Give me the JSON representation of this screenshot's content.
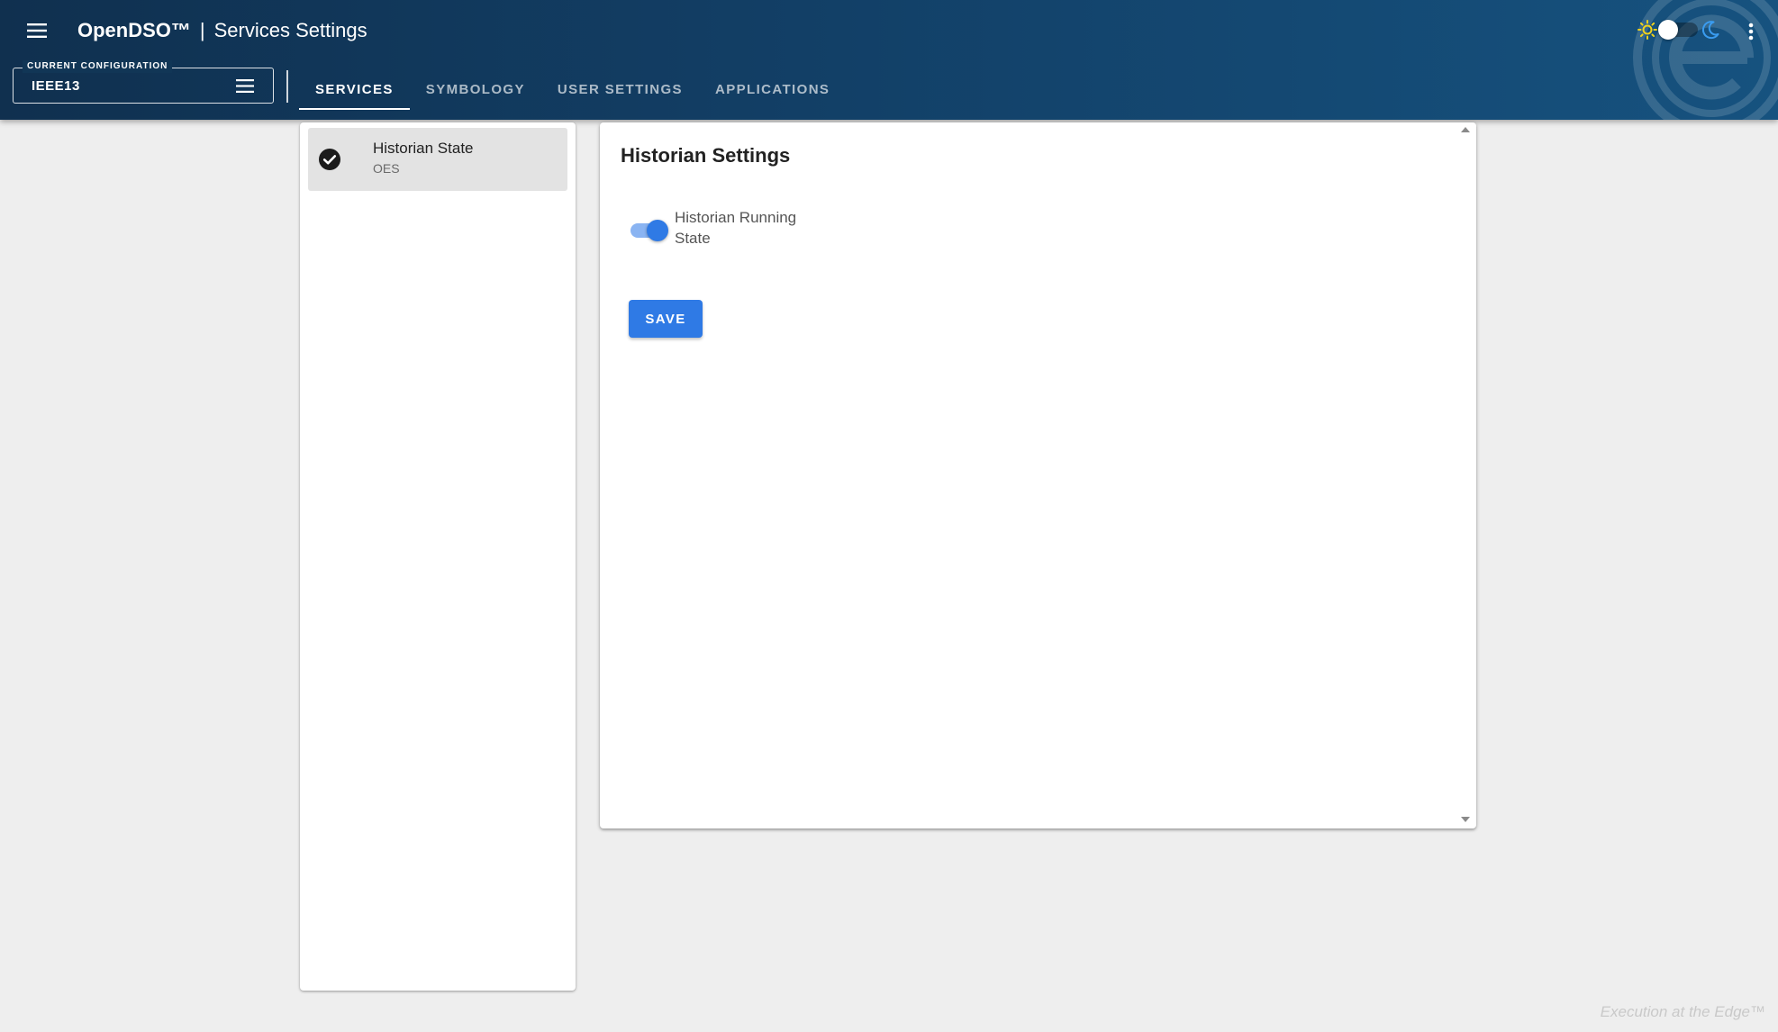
{
  "header": {
    "brand": "OpenDSO™",
    "separator": "|",
    "page_title": "Services Settings",
    "config_legend": "CURRENT CONFIGURATION",
    "config_value": "IEEE13",
    "tabs": [
      {
        "label": "SERVICES",
        "active": true
      },
      {
        "label": "SYMBOLOGY",
        "active": false
      },
      {
        "label": "USER SETTINGS",
        "active": false
      },
      {
        "label": "APPLICATIONS",
        "active": false
      }
    ],
    "theme": "light"
  },
  "services": {
    "items": [
      {
        "name": "Historian State",
        "subtitle": "OES",
        "status": "check-circle-icon"
      }
    ]
  },
  "settings": {
    "title": "Historian Settings",
    "running_switch": {
      "label": "Historian Running State",
      "on": true
    },
    "save_label": "SAVE"
  },
  "footer": {
    "tagline": "Execution at the Edge™"
  },
  "colors": {
    "header_dark": "#10304f",
    "header_light": "#16527f",
    "accent": "#2f7ae5",
    "sun": "#f2d31b",
    "moon": "#3a9cf0"
  }
}
